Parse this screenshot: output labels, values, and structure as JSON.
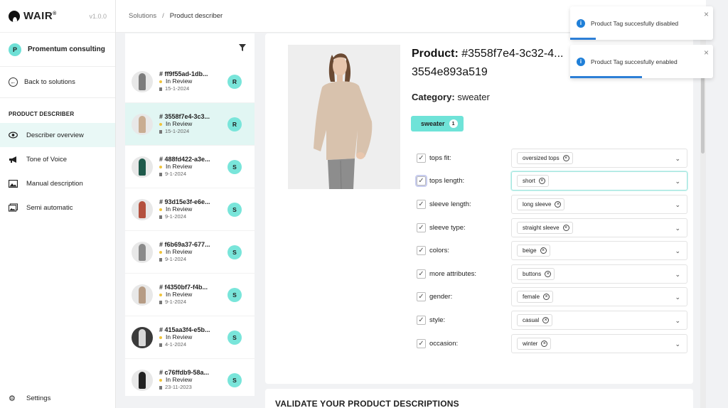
{
  "app": {
    "name": "WAIR",
    "version": "v1.0.0"
  },
  "sidebar": {
    "org_initial": "P",
    "org_name": "Promentum consulting",
    "back_label": "Back to solutions",
    "section_title": "PRODUCT DESCRIBER",
    "items": [
      {
        "label": "Describer overview",
        "icon": "eye-icon",
        "active": true
      },
      {
        "label": "Tone of Voice",
        "icon": "megaphone-icon",
        "active": false
      },
      {
        "label": "Manual description",
        "icon": "image-icon",
        "active": false
      },
      {
        "label": "Semi automatic",
        "icon": "images-icon",
        "active": false
      }
    ],
    "settings_label": "Settings"
  },
  "breadcrumb": {
    "parent": "Solutions",
    "separator": "/",
    "current": "Product describer"
  },
  "product_list": [
    {
      "id": "# ff9f55ad-1db...",
      "status": "In Review",
      "date": "15-1-2024",
      "badge": "R",
      "selected": false,
      "tone": "#7d7d7d"
    },
    {
      "id": "# 3558f7e4-3c3...",
      "status": "In Review",
      "date": "15-1-2024",
      "badge": "R",
      "selected": true,
      "tone": "#c9ad92"
    },
    {
      "id": "# 488fd422-a3e...",
      "status": "In Review",
      "date": "9-1-2024",
      "badge": "S",
      "selected": false,
      "tone": "#1f5a4b"
    },
    {
      "id": "# 93d15e3f-e6e...",
      "status": "In Review",
      "date": "9-1-2024",
      "badge": "S",
      "selected": false,
      "tone": "#b4513f"
    },
    {
      "id": "# f6b69a37-677...",
      "status": "In Review",
      "date": "9-1-2024",
      "badge": "S",
      "selected": false,
      "tone": "#8a8a8a"
    },
    {
      "id": "# f4350bf7-f4b...",
      "status": "In Review",
      "date": "9-1-2024",
      "badge": "S",
      "selected": false,
      "tone": "#b69c85"
    },
    {
      "id": "# 415aa3f4-e5b...",
      "status": "In Review",
      "date": "4-1-2024",
      "badge": "S",
      "selected": false,
      "tone": "#d8d8d8"
    },
    {
      "id": "# c76ffdb9-58a...",
      "status": "In Review",
      "date": "23-11-2023",
      "badge": "S",
      "selected": false,
      "tone": "#222222"
    }
  ],
  "product": {
    "title_label": "Product:",
    "title_value": "#3558f7e4-3c32-4... 3554e893a519",
    "category_label": "Category:",
    "category_value": "sweater",
    "tag_label": "sweater",
    "tag_count": "1"
  },
  "attributes": [
    {
      "label": "tops fit:",
      "value": "oversized tops",
      "checked": true
    },
    {
      "label": "tops length:",
      "value": "short",
      "checked": true,
      "focused": true
    },
    {
      "label": "sleeve length:",
      "value": "long sleeve",
      "checked": true
    },
    {
      "label": "sleeve type:",
      "value": "straight sleeve",
      "checked": true
    },
    {
      "label": "colors:",
      "value": "beige",
      "checked": true
    },
    {
      "label": "more attributes:",
      "value": "buttons",
      "checked": true
    },
    {
      "label": "gender:",
      "value": "female",
      "checked": true
    },
    {
      "label": "style:",
      "value": "casual",
      "checked": true
    },
    {
      "label": "occasion:",
      "value": "winter",
      "checked": true
    }
  ],
  "validate_title": "VALIDATE YOUR PRODUCT DESCRIPTIONS",
  "toasts": [
    {
      "message": "Product Tag succesfully disabled",
      "progress": 0.18
    },
    {
      "message": "Product Tag succesfully enabled",
      "progress": 0.5
    }
  ],
  "colors": {
    "accent": "#6fe3d8",
    "info": "#1f7fd8",
    "status_dot": "#f0c43c"
  }
}
